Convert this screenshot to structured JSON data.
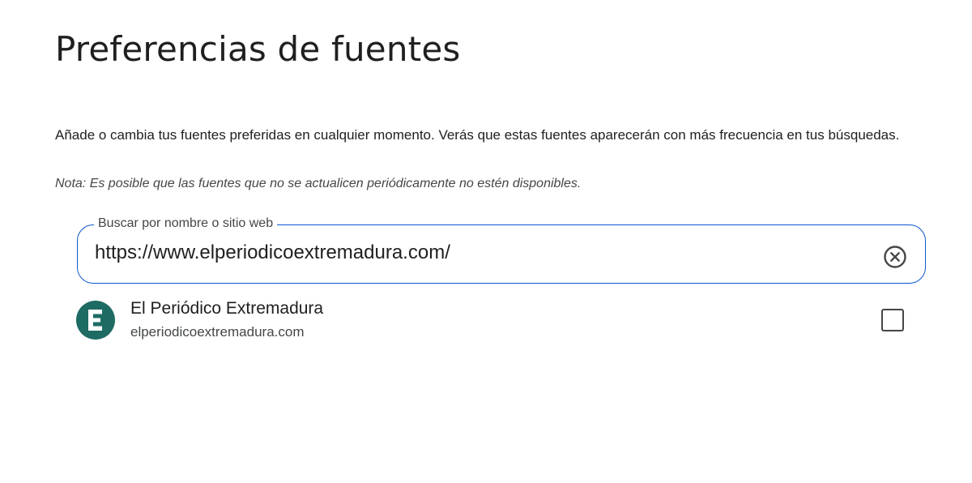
{
  "page": {
    "title": "Preferencias de fuentes",
    "description": "Añade o cambia tus fuentes preferidas en cualquier momento. Verás que estas fuentes aparecerán con más frecuencia en tus búsquedas.",
    "note": "Nota: Es posible que las fuentes que no se actualicen periódicamente no estén disponibles."
  },
  "search": {
    "label": "Buscar por nombre o sitio web",
    "value": "https://www.elperiodicoextremadura.com/",
    "clear_icon": "clear-circle-x-icon"
  },
  "results": [
    {
      "name": "El Periódico Extremadura",
      "domain": "elperiodicoextremadura.com",
      "logo_letter": "E",
      "logo_color": "#1e6b63",
      "checked": false
    }
  ],
  "colors": {
    "accent": "#0b57d0",
    "text_primary": "#1f1f1f",
    "text_secondary": "#444746"
  }
}
